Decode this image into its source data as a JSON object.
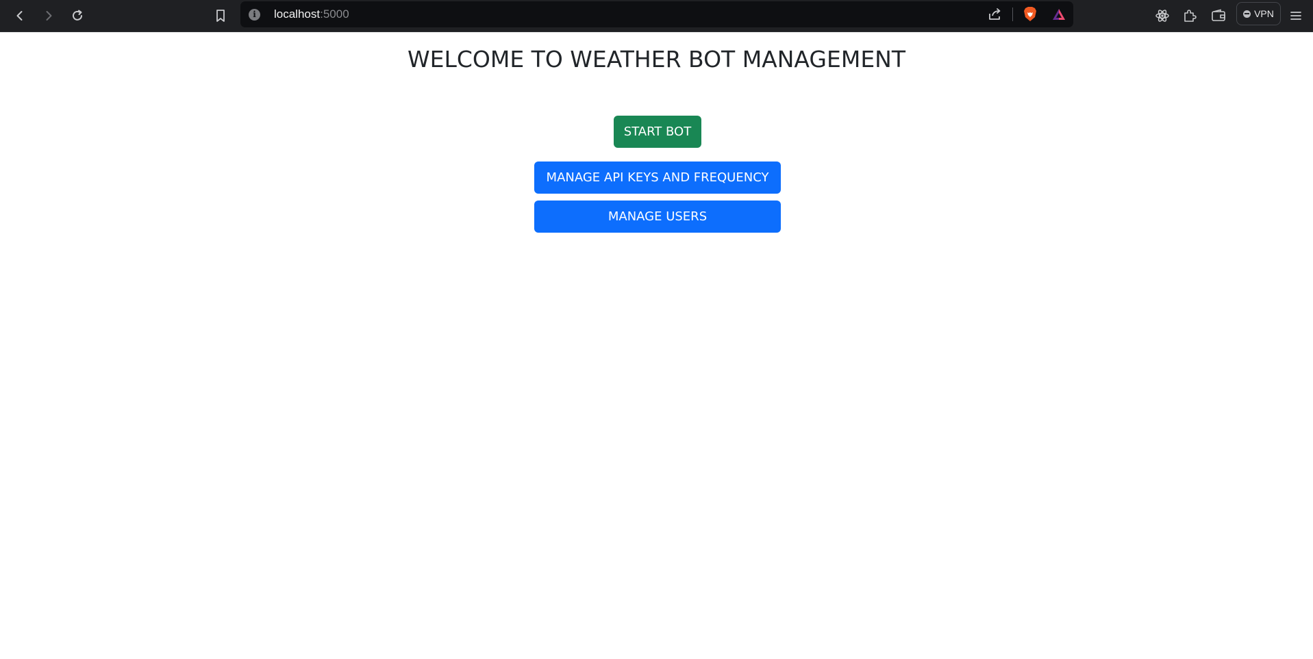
{
  "browser": {
    "url_host": "localhost",
    "url_port": ":5000",
    "vpn_label": "VPN",
    "icons": {
      "back": "back-arrow-icon",
      "forward": "forward-arrow-icon",
      "reload": "reload-icon",
      "bookmark": "bookmark-icon",
      "site_info": "info-icon",
      "share": "share-icon",
      "brave_shields": "brave-lion-icon",
      "rewards": "rewards-triangle-icon",
      "react_devtools": "atom-icon",
      "extensions": "puzzle-icon",
      "wallet": "wallet-icon",
      "menu": "hamburger-menu-icon"
    },
    "colors": {
      "toolbar_bg": "#1f2023",
      "urlbar_bg": "#0e0f12"
    }
  },
  "page": {
    "title": "WELCOME TO WEATHER BOT MANAGEMENT",
    "buttons": {
      "start_bot": "START BOT",
      "manage_api": "MANAGE API KEYS AND FREQUENCY",
      "manage_users": "MANAGE USERS"
    },
    "colors": {
      "success": "#198754",
      "primary": "#0d6efd",
      "text": "#212529"
    }
  }
}
